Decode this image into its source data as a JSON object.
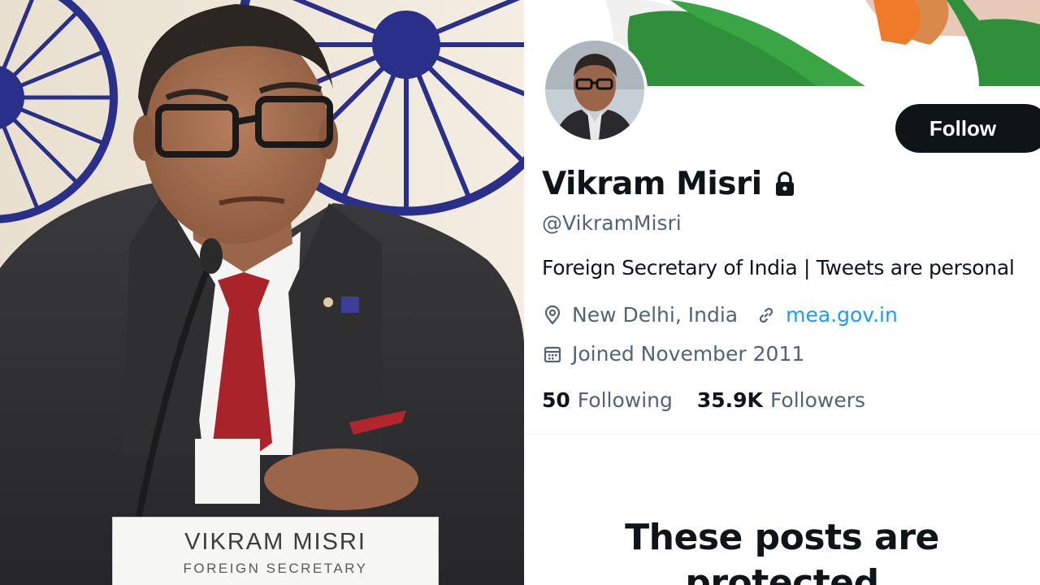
{
  "photo": {
    "nameplate_name": "VIKRAM MISRI",
    "nameplate_title": "FOREIGN SECRETARY"
  },
  "profile": {
    "display_name": "Vikram Misri",
    "handle": "@VikramMisri",
    "bio": "Foreign Secretary of India | Tweets are personal",
    "location": "New Delhi, India",
    "website": "mea.gov.in",
    "joined": "Joined November 2011",
    "follow_label": "Follow",
    "following_count": "50",
    "following_label": "Following",
    "followers_count": "35.9K",
    "followers_label": "Followers",
    "protected_line1": "These posts are",
    "protected_line2": "protected",
    "icons": {
      "lock": "lock-icon",
      "location": "location-pin-icon",
      "link": "link-icon",
      "calendar": "calendar-icon"
    }
  },
  "colors": {
    "link_blue": "#1d9bf0",
    "text_primary": "#0f1419",
    "text_secondary": "#536471",
    "follow_button_bg": "#0f1419",
    "chakra_blue": "#2a2f8a"
  }
}
